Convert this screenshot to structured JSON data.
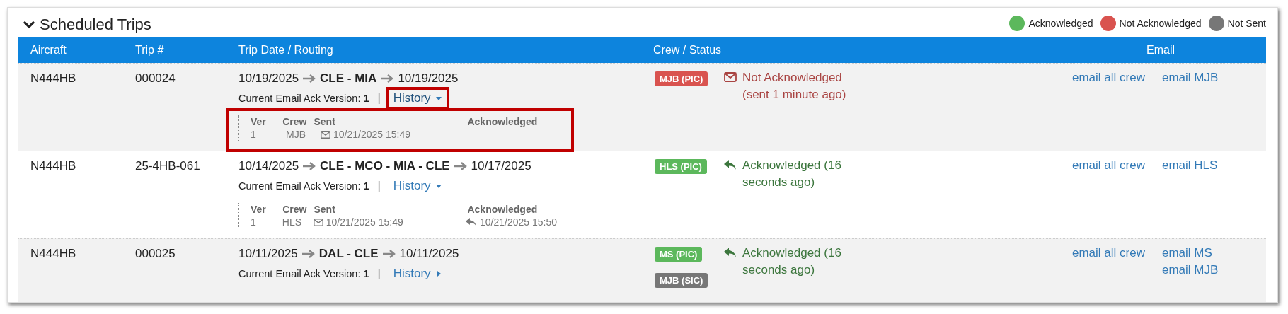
{
  "title": "Scheduled Trips",
  "legend": [
    {
      "label": "Acknowledged",
      "color": "#5cb85c"
    },
    {
      "label": "Not Acknowledged",
      "color": "#d9534f"
    },
    {
      "label": "Not Sent",
      "color": "#777777"
    }
  ],
  "columns": [
    "Aircraft",
    "Trip #",
    "Trip Date / Routing",
    "Crew / Status",
    "Email"
  ],
  "trips": [
    {
      "aircraft": "N444HB",
      "trip": "000024",
      "date_from": "10/19/2025",
      "route": "CLE - MIA",
      "date_to": "10/19/2025",
      "ack_label": "Current Email Ack Version:",
      "ack_version": "1",
      "separator": "|",
      "history_label": "History",
      "history_expanded": true,
      "highlighted": true,
      "history": {
        "columns": [
          "Ver",
          "Crew",
          "Sent",
          "Acknowledged"
        ],
        "rows": [
          {
            "ver": "1",
            "crew": "MJB",
            "sent": "10/21/2025 15:49"
          }
        ]
      },
      "crew": [
        {
          "badge": "MJB (PIC)",
          "color": "#d9534f"
        }
      ],
      "status": {
        "kind": "not_acknowledged",
        "text": "Not Acknowledged (sent 1 minute ago)"
      },
      "emails": [
        "email all crew",
        "email MJB"
      ]
    },
    {
      "aircraft": "N444HB",
      "trip": "25-4HB-061",
      "date_from": "10/14/2025",
      "route": "CLE - MCO - MIA - CLE",
      "date_to": "10/17/2025",
      "ack_label": "Current Email Ack Version:",
      "ack_version": "1",
      "separator": "|",
      "history_label": "History",
      "history_expanded": true,
      "highlighted": false,
      "history": {
        "columns": [
          "Ver",
          "Crew",
          "Sent",
          "Acknowledged"
        ],
        "rows": [
          {
            "ver": "1",
            "crew": "HLS",
            "sent": "10/21/2025 15:49",
            "acknowledged": "10/21/2025 15:50"
          }
        ]
      },
      "crew": [
        {
          "badge": "HLS (PIC)",
          "color": "#5cb85c"
        }
      ],
      "status": {
        "kind": "acknowledged",
        "text": "Acknowledged (16 seconds ago)"
      },
      "emails": [
        "email all crew",
        "email HLS"
      ]
    },
    {
      "aircraft": "N444HB",
      "trip": "000025",
      "date_from": "10/11/2025",
      "route": "DAL - CLE",
      "date_to": "10/11/2025",
      "ack_label": "Current Email Ack Version:",
      "ack_version": "1",
      "separator": "|",
      "history_label": "History",
      "history_expanded": false,
      "highlighted": false,
      "crew": [
        {
          "badge": "MS (PIC)",
          "color": "#5cb85c"
        },
        {
          "badge": "MJB (SIC)",
          "color": "#777777"
        }
      ],
      "status": {
        "kind": "acknowledged",
        "text": "Acknowledged (16 seconds ago)"
      },
      "emails": [
        "email all crew",
        "email MS",
        "email MJB"
      ]
    }
  ]
}
